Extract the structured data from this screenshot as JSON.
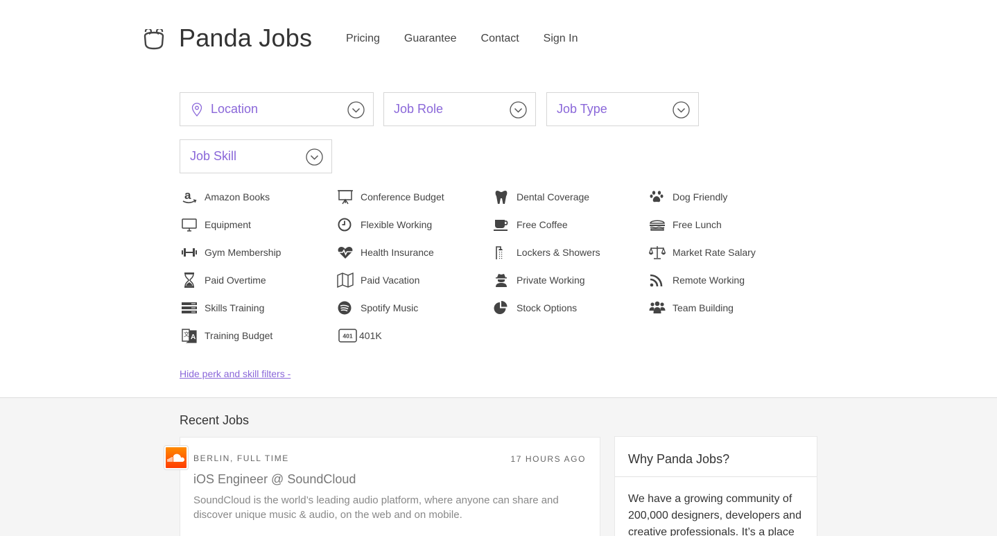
{
  "header": {
    "brand": "Panda Jobs",
    "nav": [
      "Pricing",
      "Guarantee",
      "Contact",
      "Sign In"
    ]
  },
  "filters": {
    "location": "Location",
    "job_role": "Job Role",
    "job_type": "Job Type",
    "job_skill": "Job Skill"
  },
  "perks": [
    {
      "label": "Amazon Books",
      "icon": "amazon-icon"
    },
    {
      "label": "Conference Budget",
      "icon": "easel-icon"
    },
    {
      "label": "Dental Coverage",
      "icon": "tooth-icon"
    },
    {
      "label": "Dog Friendly",
      "icon": "paw-icon"
    },
    {
      "label": "Equipment",
      "icon": "monitor-icon"
    },
    {
      "label": "Flexible Working",
      "icon": "clock-icon"
    },
    {
      "label": "Free Coffee",
      "icon": "coffee-icon"
    },
    {
      "label": "Free Lunch",
      "icon": "burger-icon"
    },
    {
      "label": "Gym Membership",
      "icon": "dumbbell-icon"
    },
    {
      "label": "Health Insurance",
      "icon": "heartbeat-icon"
    },
    {
      "label": "Lockers & Showers",
      "icon": "shower-icon"
    },
    {
      "label": "Market Rate Salary",
      "icon": "scales-icon"
    },
    {
      "label": "Paid Overtime",
      "icon": "hourglass-icon"
    },
    {
      "label": "Paid Vacation",
      "icon": "map-icon"
    },
    {
      "label": "Private Working",
      "icon": "spy-icon"
    },
    {
      "label": "Remote Working",
      "icon": "rss-icon"
    },
    {
      "label": "Skills Training",
      "icon": "server-icon"
    },
    {
      "label": "Spotify Music",
      "icon": "spotify-icon"
    },
    {
      "label": "Stock Options",
      "icon": "pie-chart-icon"
    },
    {
      "label": "Team Building",
      "icon": "users-icon"
    },
    {
      "label": "Training Budget",
      "icon": "translate-icon"
    },
    {
      "label": "401K",
      "icon": "401k-icon",
      "badge": "401"
    }
  ],
  "hide_filters_link": "Hide perk and skill filters -",
  "recent": {
    "title": "Recent Jobs",
    "job": {
      "meta": "BERLIN, FULL TIME",
      "time": "17 HOURS AGO",
      "title": "iOS Engineer @ SoundCloud",
      "description": "SoundCloud is the world’s leading audio platform, where anyone can share and discover unique music & audio, on the web and on mobile."
    }
  },
  "why": {
    "title": "Why Panda Jobs?",
    "text": "We have a growing community of 200,000 designers, developers and creative professionals. It’s a place"
  },
  "colors": {
    "accent": "#8a67d9",
    "lower_bg": "#f5f5f5",
    "soundcloud": "#ff5500"
  }
}
